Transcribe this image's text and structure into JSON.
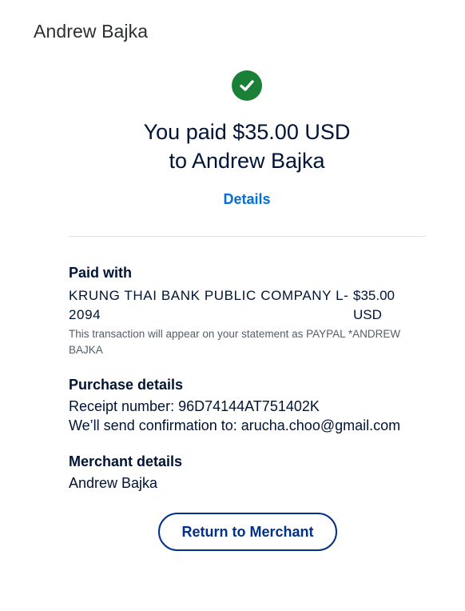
{
  "header": {
    "merchant_name": "Andrew Bajka"
  },
  "confirmation": {
    "icon": "check-circle-icon",
    "line1": "You paid $35.00 USD",
    "line2": "to Andrew Bajka",
    "details_link": "Details"
  },
  "paid_with": {
    "title": "Paid with",
    "bank_line1": "KRUNG THAI BANK PUBLIC COMPANY L-",
    "bank_line2": "2094",
    "amount_line1": "$35.00",
    "amount_line2": "USD",
    "statement_note": "This transaction will appear on your statement as PAYPAL *ANDREW BAJKA"
  },
  "purchase_details": {
    "title": "Purchase details",
    "receipt": "Receipt number: 96D74144AT751402K",
    "confirmation": "We’ll send confirmation to: arucha.choo@gmail.com"
  },
  "merchant_details": {
    "title": "Merchant details",
    "name": "Andrew Bajka"
  },
  "actions": {
    "return_label": "Return to Merchant"
  },
  "colors": {
    "success": "#1a7f37",
    "link": "#0070e0",
    "button_border": "#003087",
    "text": "#001435"
  }
}
